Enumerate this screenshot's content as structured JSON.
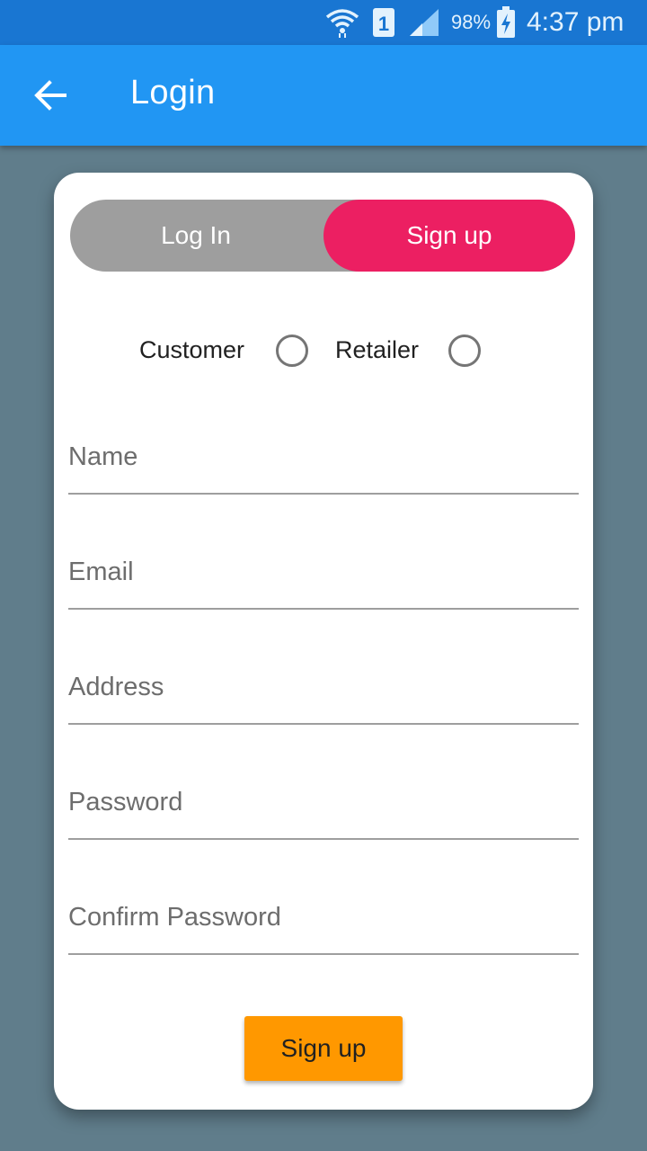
{
  "status_bar": {
    "sim_slot": "1",
    "battery_percent": "98%",
    "time": "4:37 pm",
    "icons": [
      "wifi-icon",
      "sim-icon",
      "signal-icon",
      "battery-charging-icon"
    ]
  },
  "app_bar": {
    "back_icon": "arrow-back-icon",
    "title": "Login",
    "color": "#2196f3"
  },
  "auth_toggle": {
    "login_label": "Log In",
    "signup_label": "Sign up",
    "active": "signup",
    "active_color": "#ec1f62"
  },
  "role": {
    "customer_label": "Customer",
    "retailer_label": "Retailer",
    "selected": null
  },
  "form": {
    "name": {
      "placeholder": "Name",
      "value": ""
    },
    "email": {
      "placeholder": "Email",
      "value": ""
    },
    "address": {
      "placeholder": "Address",
      "value": ""
    },
    "password": {
      "placeholder": "Password",
      "value": ""
    },
    "confirm_password": {
      "placeholder": "Confirm Password",
      "value": ""
    }
  },
  "submit": {
    "label": "Sign up",
    "color": "#ff9800"
  }
}
